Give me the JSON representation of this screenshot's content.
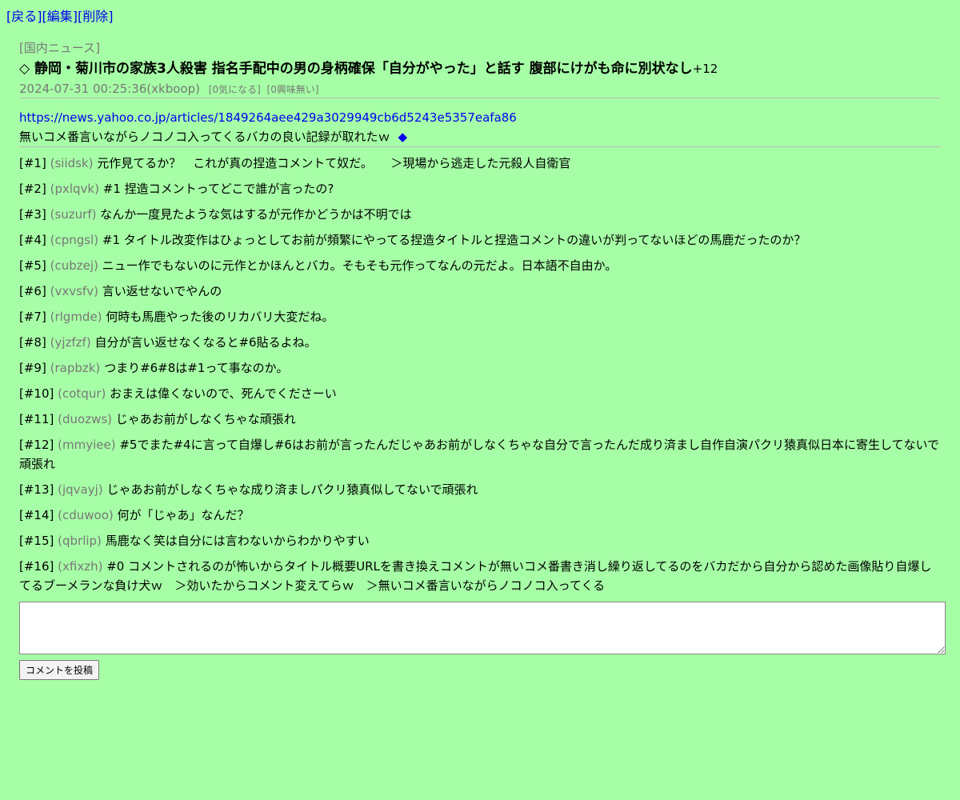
{
  "nav": {
    "back": "[戻る]",
    "edit": "[編集]",
    "delete": "[削除]"
  },
  "article": {
    "category": "[国内ニュース]",
    "title": "◇ 静岡・菊川市の家族3人殺害 指名手配中の男の身柄確保「自分がやった」と話す 腹部にけがも命に別状なし",
    "score": "+12",
    "datetime_user": "2024-07-31 00:25:36(xkboop)",
    "interested": "[0気になる]",
    "not_interested": "[0興味無い]",
    "url": "https://news.yahoo.co.jp/articles/1849264aee429a3029949cb6d5243e5357eafa86",
    "summary": "無いコメ番言いながらノコノコ入ってくるバカの良い記録が取れたｗ",
    "diamond": "◆"
  },
  "comments": [
    {
      "num": "[#1]",
      "user": "(siidsk)",
      "text": "元作見てるか？　これが真の捏造コメントて奴だ。　　＞現場から逃走した元殺人自衛官"
    },
    {
      "num": "[#2]",
      "user": "(pxlqvk)",
      "text": "#1 捏造コメントってどこで誰が言ったの?"
    },
    {
      "num": "[#3]",
      "user": "(suzurf)",
      "text": "なんか一度見たような気はするが元作かどうかは不明では"
    },
    {
      "num": "[#4]",
      "user": "(cpngsl)",
      "text": "#1 タイトル改変作はひょっとしてお前が頻繁にやってる捏造タイトルと捏造コメントの違いが判ってないほどの馬鹿だったのか？"
    },
    {
      "num": "[#5]",
      "user": "(cubzej)",
      "text": "ニュー作でもないのに元作とかほんとバカ。そもそも元作ってなんの元だよ。日本語不自由か。"
    },
    {
      "num": "[#6]",
      "user": "(vxvsfv)",
      "text": "言い返せないでやんの"
    },
    {
      "num": "[#7]",
      "user": "(rlgmde)",
      "text": "何時も馬鹿やった後のリカバリ大変だね。"
    },
    {
      "num": "[#8]",
      "user": "(yjzfzf)",
      "text": "自分が言い返せなくなると#6貼るよね。"
    },
    {
      "num": "[#9]",
      "user": "(rapbzk)",
      "text": "つまり#6#8は#1って事なのか。"
    },
    {
      "num": "[#10]",
      "user": "(cotqur)",
      "text": "おまえは偉くないので、死んでくださーい"
    },
    {
      "num": "[#11]",
      "user": "(duozws)",
      "text": "じゃあお前がしなくちゃな頑張れ"
    },
    {
      "num": "[#12]",
      "user": "(mmyiee)",
      "text": "#5でまた#4に言って自爆し#6はお前が言ったんだじゃあお前がしなくちゃな自分で言ったんだ成り済まし自作自演パクリ猿真似日本に寄生してないで頑張れ"
    },
    {
      "num": "[#13]",
      "user": "(jqvayj)",
      "text": "じゃあお前がしなくちゃな成り済ましパクリ猿真似してないで頑張れ"
    },
    {
      "num": "[#14]",
      "user": "(cduwoo)",
      "text": "何が「じゃあ」なんだ？"
    },
    {
      "num": "[#15]",
      "user": "(qbrlip)",
      "text": "馬鹿なく笑は自分には言わないからわかりやすい"
    },
    {
      "num": "[#16]",
      "user": "(xfixzh)",
      "text": "#0 コメントされるのが怖いからタイトル概要URLを書き換えコメントが無いコメ番書き消し繰り返してるのをバカだから自分から認めた画像貼り自爆してるブーメランな負け犬ｗ　＞効いたからコメント変えてらｗ　＞無いコメ番言いながらノコノコ入ってくる"
    }
  ],
  "form": {
    "submit_label": "コメントを投稿"
  },
  "colors": {
    "background": "#a6ffa6",
    "link": "#0000ee",
    "muted": "#777777"
  }
}
